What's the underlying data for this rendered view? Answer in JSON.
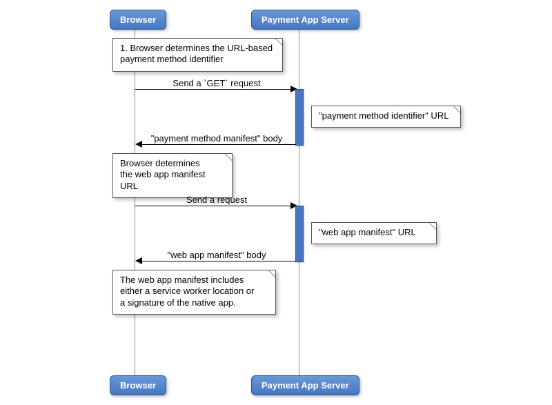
{
  "participants": {
    "browser": "Browser",
    "server": "Payment App Server"
  },
  "notes": {
    "n1_line1": "1. Browser determines the URL-based",
    "n1_line2": "payment method identifier",
    "n2": "\"payment method identifier\" URL",
    "n3_line1": "Browser determines",
    "n3_line2": "the web app manifest URL",
    "n4": "\"web app manifest\" URL",
    "n5_line1": "The web app manifest includes",
    "n5_line2": "either a service worker location or",
    "n5_line3": "a signature of the native app."
  },
  "messages": {
    "m1": "Send a `GET` request",
    "m2": "\"payment method manifest\" body",
    "m3": "Send a request",
    "m4": "\"web app manifest\" body"
  }
}
